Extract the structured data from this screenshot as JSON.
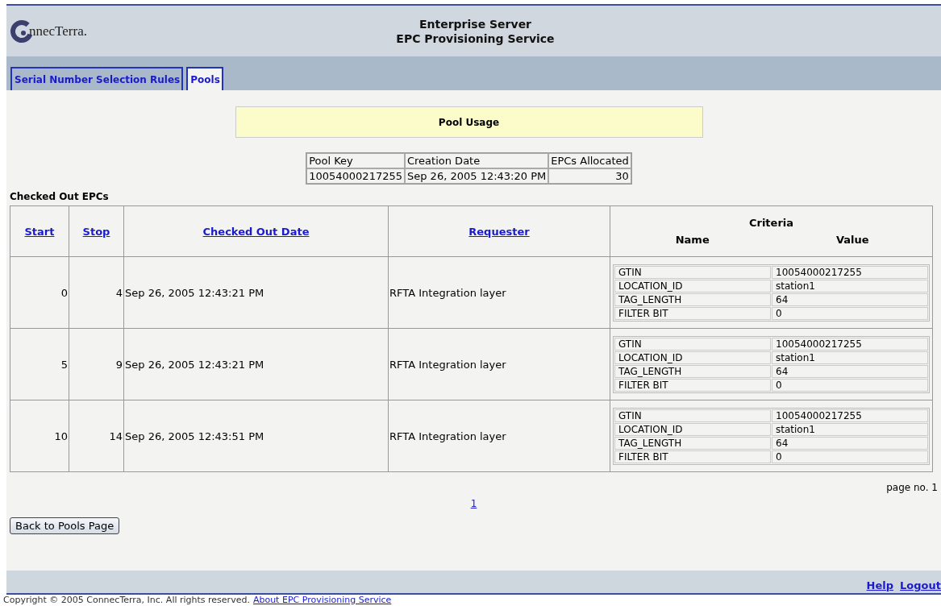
{
  "header": {
    "logo_text": "nnecTerra.",
    "title_lines": [
      "Enterprise Server",
      "EPC Provisioning Service"
    ]
  },
  "tabs": [
    {
      "label": "Serial Number Selection Rules",
      "selected": false
    },
    {
      "label": "Pools",
      "selected": true
    }
  ],
  "pool_usage": {
    "title": "Pool Usage",
    "columns": [
      "Pool Key",
      "Creation Date",
      "EPCs Allocated"
    ],
    "row": [
      "10054000217255",
      "Sep 26, 2005 12:43:20 PM",
      "30"
    ]
  },
  "checked_out": {
    "title": "Checked Out EPCs",
    "columns": [
      "Start",
      "Stop",
      "Checked Out Date",
      "Requester"
    ],
    "criteria_heading": "Criteria",
    "criteria_columns": [
      "Name",
      "Value"
    ],
    "rows": [
      {
        "start": "0",
        "stop": "4",
        "date": "Sep 26, 2005 12:43:21 PM",
        "requester": "RFTA Integration layer",
        "criteria": [
          [
            "GTIN",
            "10054000217255"
          ],
          [
            "LOCATION_ID",
            "station1"
          ],
          [
            "TAG_LENGTH",
            "64"
          ],
          [
            "FILTER BIT",
            "0"
          ]
        ]
      },
      {
        "start": "5",
        "stop": "9",
        "date": "Sep 26, 2005 12:43:21 PM",
        "requester": "RFTA Integration layer",
        "criteria": [
          [
            "GTIN",
            "10054000217255"
          ],
          [
            "LOCATION_ID",
            "station1"
          ],
          [
            "TAG_LENGTH",
            "64"
          ],
          [
            "FILTER BIT",
            "0"
          ]
        ]
      },
      {
        "start": "10",
        "stop": "14",
        "date": "Sep 26, 2005 12:43:51 PM",
        "requester": "RFTA Integration layer",
        "criteria": [
          [
            "GTIN",
            "10054000217255"
          ],
          [
            "LOCATION_ID",
            "station1"
          ],
          [
            "TAG_LENGTH",
            "64"
          ],
          [
            "FILTER BIT",
            "0"
          ]
        ]
      }
    ]
  },
  "page_label": "page no. 1",
  "pages": [
    "1"
  ],
  "back_button": "Back to Pools Page",
  "footer": {
    "links": [
      "Help",
      "Logout"
    ],
    "copyright": "Copyright © 2005 ConnecTerra, Inc. All rights reserved.",
    "about_link": "About EPC Provisioning Service"
  }
}
